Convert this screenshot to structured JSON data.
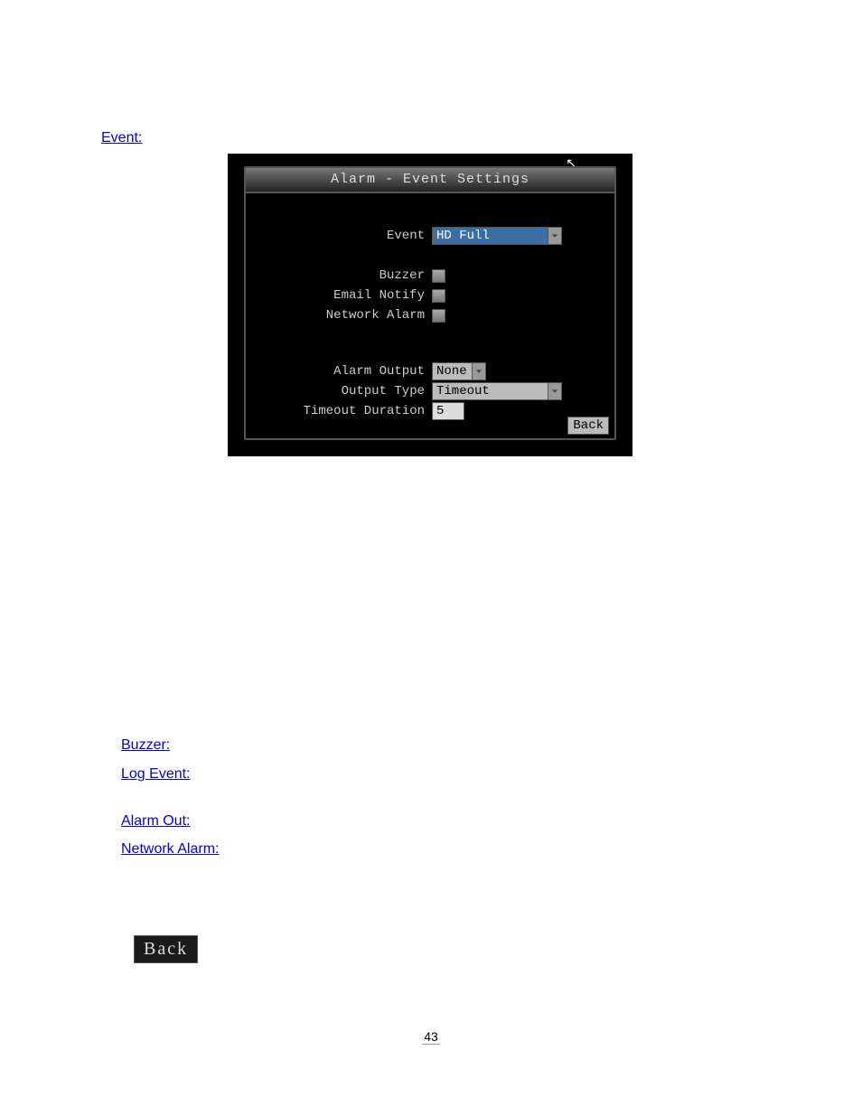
{
  "links": {
    "a": "Event:",
    "b": "Buzzer:",
    "c": "Log Event:",
    "d": "Alarm Out:",
    "e": "Network Alarm:"
  },
  "title": "Alarm - Event Settings",
  "labels": {
    "event": "Event",
    "buzzer": "Buzzer",
    "email": "Email Notify",
    "network": "Network Alarm",
    "alarmout": "Alarm Output",
    "outtype": "Output Type",
    "timeout": "Timeout Duration"
  },
  "values": {
    "event": "HD Full",
    "alarmout": "None",
    "outtype": "Timeout",
    "timeout": "5"
  },
  "backBtn": "Back",
  "backImg": "Back",
  "pageNumber": "43"
}
